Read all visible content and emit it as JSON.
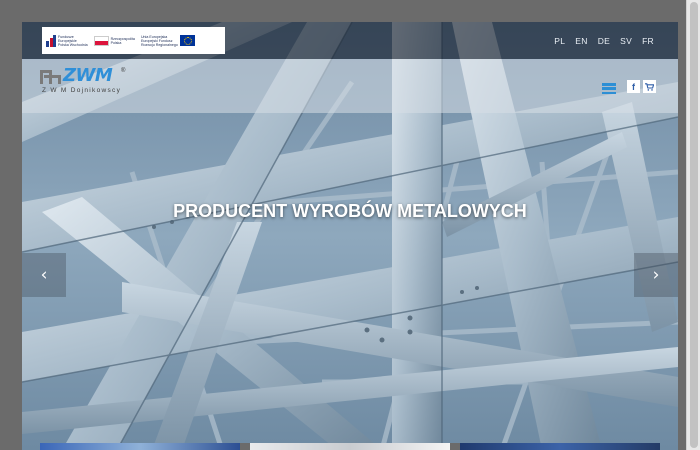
{
  "eu_logos": {
    "fundusze": "Fundusze\nEuropejskie\nPolska Wschodnia",
    "rzeczpospolita": "Rzeczpospolita\nPolska",
    "unia": "Unia Europejska\nEuropejski Fundusz\nRozwoju Regionalnego"
  },
  "languages": [
    "PL",
    "EN",
    "DE",
    "SV",
    "FR"
  ],
  "logo": {
    "word": "ZWM",
    "registered": "®",
    "subtitle": "Z W M Dojnikowscy"
  },
  "social": {
    "facebook": "f",
    "cart": "🛒"
  },
  "hero": {
    "headline": "PRODUCENT WYROBÓW METALOWYCH",
    "prev_arrow": "‹",
    "next_arrow": "›"
  },
  "colors": {
    "accent": "#2d8fd5",
    "page_background": "#6b6b6b",
    "sky": "#7e97ad",
    "steel": "#b9c9d6"
  },
  "icons": {
    "menu": "hamburger-icon",
    "facebook": "facebook-icon",
    "cart": "cart-icon",
    "prev": "chevron-left-icon",
    "next": "chevron-right-icon"
  }
}
